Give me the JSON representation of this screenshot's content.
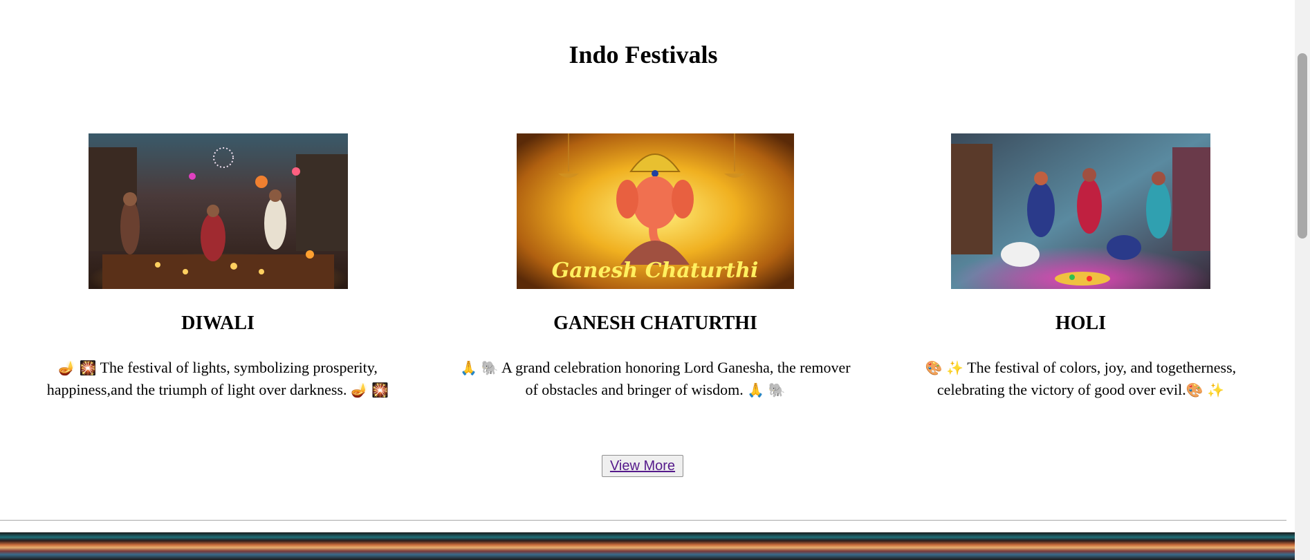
{
  "page": {
    "title": "Indo Festivals",
    "view_more_label": "View More"
  },
  "festivals": [
    {
      "name": "DIWALI",
      "icon": "diwali-image",
      "desc_line1": "The festival of lights, symbolizing prosperity,",
      "desc_line2": "happiness,and the triumph of light over darkness.",
      "emoji_a": "🪔",
      "emoji_b": "🎇"
    },
    {
      "name": "GANESH CHATURTHI",
      "icon": "ganesh-image",
      "image_caption": "Ganesh Chaturthi",
      "desc_line1": "A grand celebration honoring Lord Ganesha, the remover",
      "desc_line2": "of obstacles and bringer of wisdom.",
      "emoji_a": "🙏",
      "emoji_b": "🐘"
    },
    {
      "name": "HOLI",
      "icon": "holi-image",
      "desc_line1": "The festival of colors, joy, and togetherness,",
      "desc_line2": "celebrating the victory of good over evil.",
      "emoji_a": "🎨",
      "emoji_b": "✨"
    }
  ],
  "colors": {
    "link": "#551a8b",
    "button_bg": "#efefef",
    "scrollbar_thumb": "#a8a8a8"
  }
}
